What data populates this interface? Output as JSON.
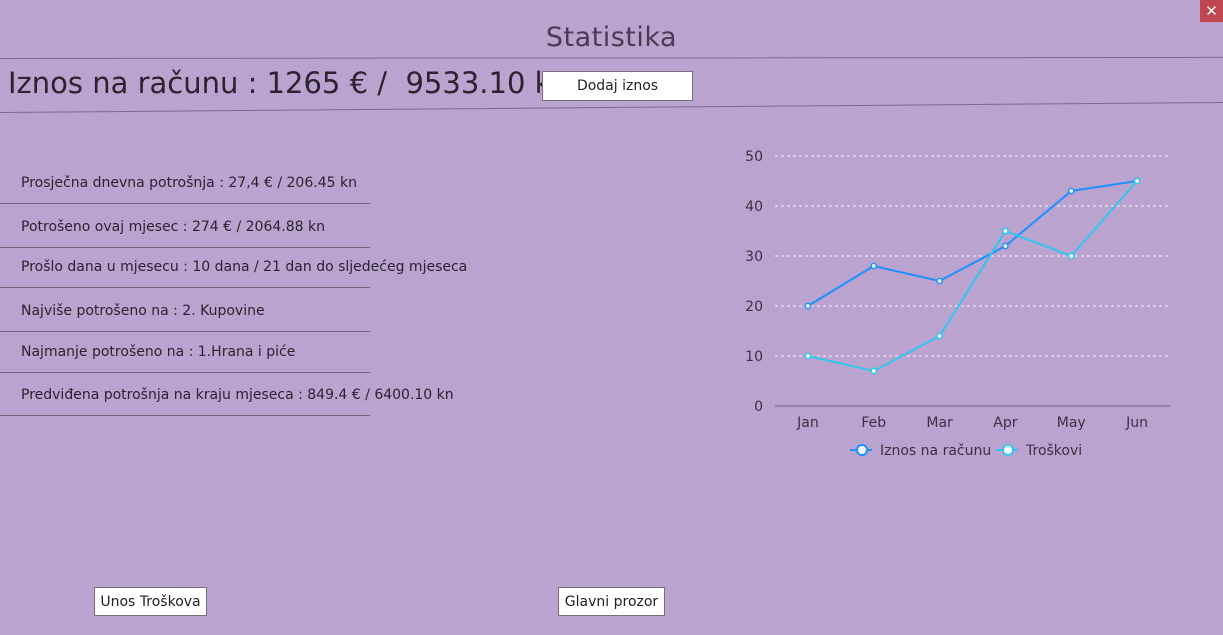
{
  "window": {
    "title": "Statistika",
    "close_symbol": "✕"
  },
  "balance": {
    "text": "Iznos na računu : 1265 € /  9533.10 kn",
    "add_button": "Dodaj iznos"
  },
  "stats": [
    {
      "text": "Prosječna dnevna potrošnja : 27,4 € / 206.45 kn"
    },
    {
      "text": "Potrošeno ovaj mjesec : 274 € / 2064.88 kn"
    },
    {
      "text": "Prošlo dana u mjesecu : 10 dana / 21 dan do sljedećeg mjeseca"
    },
    {
      "text": "Najviše potrošeno na : 2. Kupovine"
    },
    {
      "text": "Najmanje potrošeno na : 1.Hrana i piće"
    },
    {
      "text": "Predviđena potrošnja na kraju mjeseca : 849.4 € / 6400.10 kn"
    }
  ],
  "buttons": {
    "expenses": "Unos Troškova",
    "main_window": "Glavni prozor"
  },
  "chart_data": {
    "type": "line",
    "categories": [
      "Jan",
      "Feb",
      "Mar",
      "Apr",
      "May",
      "Jun"
    ],
    "ylim": [
      0,
      50
    ],
    "yticks": [
      0,
      10,
      20,
      30,
      40,
      50
    ],
    "grid": true,
    "legend_position": "bottom",
    "series": [
      {
        "name": "Iznos na računu",
        "values": [
          20,
          28,
          25,
          32,
          43,
          45
        ],
        "color": "#1e90ff"
      },
      {
        "name": "Troškovi",
        "values": [
          10,
          7,
          14,
          35,
          30,
          45
        ],
        "color": "#2fc7f0"
      }
    ]
  }
}
